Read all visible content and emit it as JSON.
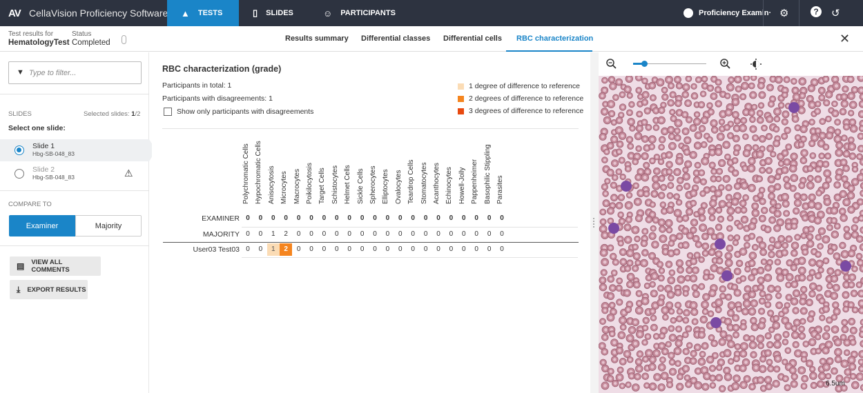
{
  "topbar": {
    "logo": "AV",
    "app_title": "CellaVision Proficiency Software",
    "tabs": [
      {
        "label": "TESTS",
        "active": true
      },
      {
        "label": "SLIDES",
        "active": false
      },
      {
        "label": "PARTICIPANTS",
        "active": false
      }
    ],
    "user_label": "Proficiency Examin·",
    "accent_color": "#1a85c8",
    "bar_color": "#2d3340"
  },
  "subheader": {
    "test_results_label": "Test results for",
    "test_name": "HematologyTest",
    "status_label": "Status",
    "status_value": "Completed",
    "tabs": [
      {
        "label": "Results summary",
        "active": false
      },
      {
        "label": "Differential classes",
        "active": false
      },
      {
        "label": "Differential cells",
        "active": false
      },
      {
        "label": "RBC characterization",
        "active": true
      }
    ]
  },
  "sidebar": {
    "filter_placeholder": "Type to filter...",
    "slides_heading": "SLIDES",
    "selected_slides_label": "Selected slides:",
    "selected_count": "1",
    "selected_total": "/2",
    "select_prompt": "Select one slide:",
    "slides": [
      {
        "name": "Slide 1",
        "code": "Hbg-SB-048_83",
        "selected": true,
        "warning": false
      },
      {
        "name": "Slide 2",
        "code": "Hbg-SB-048_83",
        "selected": false,
        "warning": true
      }
    ],
    "compare_heading": "COMPARE TO",
    "compare_options": [
      {
        "label": "Examiner",
        "active": true
      },
      {
        "label": "Majority",
        "active": false
      }
    ],
    "view_comments_label": "VIEW ALL COMMENTS",
    "export_label": "EXPORT RESULTS"
  },
  "main": {
    "title": "RBC characterization (grade)",
    "participants_total_label": "Participants in total: 1",
    "participants_disagree_label": "Participants with disagreements: 1",
    "show_only_label": "Show only participants with disagreements",
    "legend": [
      {
        "label": "1 degree of difference to reference",
        "color": "#fbdcb5"
      },
      {
        "label": "2 degrees of difference to reference",
        "color": "#f5851f"
      },
      {
        "label": "3 degrees of difference to reference",
        "color": "#e8490f"
      }
    ],
    "columns": [
      "Polychromatic Cells",
      "Hypochromatic Cells",
      "Anisocytosis",
      "Microcytes",
      "Macrocytes",
      "Poikilocytosis",
      "Target Cells",
      "Schistocytes",
      "Helmet Cells",
      "Sickle Cells",
      "Spherocytes",
      "Elliptocytes",
      "Ovalocytes",
      "Teardrop Cells",
      "Stomatocytes",
      "Acanthocytes",
      "Echinocytes",
      "Howell-Jolly",
      "Pappenheimer",
      "Basophilic Stippling",
      "Parasites"
    ],
    "rows": [
      {
        "label": "EXAMINER",
        "bold": true,
        "values": [
          "0",
          "0",
          "0",
          "0",
          "0",
          "0",
          "0",
          "0",
          "0",
          "0",
          "0",
          "0",
          "0",
          "0",
          "0",
          "0",
          "0",
          "0",
          "0",
          "0",
          "0"
        ],
        "diff": [
          0,
          0,
          0,
          0,
          0,
          0,
          0,
          0,
          0,
          0,
          0,
          0,
          0,
          0,
          0,
          0,
          0,
          0,
          0,
          0,
          0
        ]
      },
      {
        "label": "MAJORITY",
        "bold": false,
        "values": [
          "0",
          "0",
          "1",
          "2",
          "0",
          "0",
          "0",
          "0",
          "0",
          "0",
          "0",
          "0",
          "0",
          "0",
          "0",
          "0",
          "0",
          "0",
          "0",
          "0",
          "0"
        ],
        "diff": [
          0,
          0,
          0,
          0,
          0,
          0,
          0,
          0,
          0,
          0,
          0,
          0,
          0,
          0,
          0,
          0,
          0,
          0,
          0,
          0,
          0
        ]
      },
      {
        "label": "User03 Test03",
        "bold": false,
        "values": [
          "0",
          "0",
          "1",
          "2",
          "0",
          "0",
          "0",
          "0",
          "0",
          "0",
          "0",
          "0",
          "0",
          "0",
          "0",
          "0",
          "0",
          "0",
          "0",
          "0",
          "0"
        ],
        "diff": [
          0,
          0,
          1,
          2,
          0,
          0,
          0,
          0,
          0,
          0,
          0,
          0,
          0,
          0,
          0,
          0,
          0,
          0,
          0,
          0,
          0
        ]
      }
    ]
  },
  "viewer": {
    "zoom_level": 0.15,
    "scale_label": "6.5um"
  }
}
